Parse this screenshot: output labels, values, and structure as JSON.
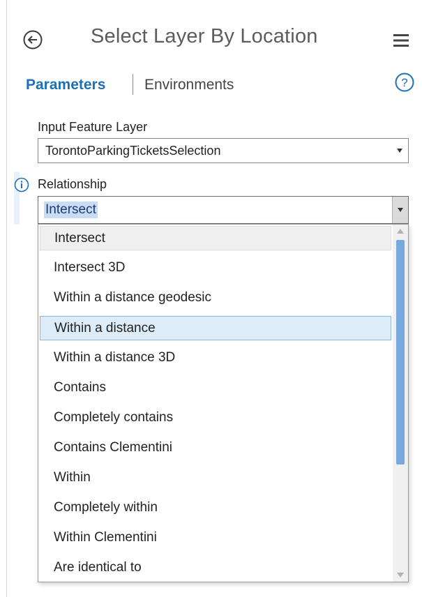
{
  "header": {
    "title": "Select Layer By Location"
  },
  "tabs": {
    "parameters": "Parameters",
    "environments": "Environments"
  },
  "params": {
    "input_feature_layer": {
      "label": "Input Feature Layer",
      "value": "TorontoParkingTicketsSelection"
    },
    "relationship": {
      "label": "Relationship",
      "value": "Intersect",
      "options": [
        "Intersect",
        "Intersect 3D",
        "Within a distance geodesic",
        "Within a distance",
        "Within a distance 3D",
        "Contains",
        "Completely contains",
        "Contains Clementini",
        "Within",
        "Completely within",
        "Within Clementini",
        "Are identical to"
      ]
    }
  },
  "colors": {
    "accent": "#1f6fb5",
    "selected_bg": "#dcecf9",
    "scroll_thumb": "#77a9de"
  },
  "icons": {
    "back": "back-arrow-circle-icon",
    "menu": "hamburger-menu-icon",
    "help": "help-question-circle-icon",
    "info": "info-circle-icon"
  }
}
